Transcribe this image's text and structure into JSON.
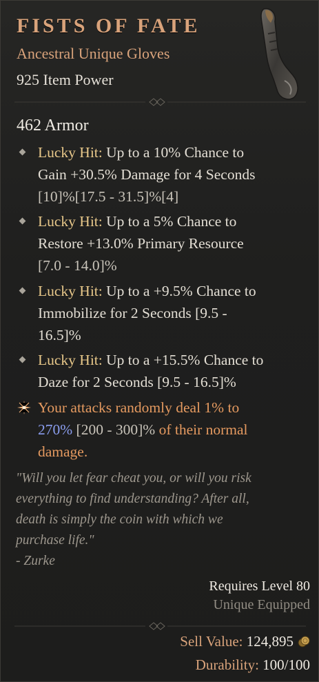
{
  "item": {
    "name": "FISTS OF FATE",
    "type": "Ancestral Unique Gloves",
    "item_power": "925 Item Power",
    "armor": "462 Armor",
    "image_icon": "gloves-icon"
  },
  "affixes": [
    {
      "prefix": "Lucky Hit:",
      "line1": " Up to a 10% Chance to",
      "line2": "Gain +30.5% Damage for 4 Seconds",
      "line3": "[10]%[17.5 - 31.5]%[4]"
    },
    {
      "prefix": "Lucky Hit:",
      "line1": " Up to a 5% Chance to",
      "line2": "Restore +13.0% Primary Resource",
      "line3": "[7.0 - 14.0]%"
    },
    {
      "prefix": "Lucky Hit:",
      "line1": " Up to a +9.5% Chance to",
      "line2": "Immobilize for 2 Seconds [9.5 -",
      "line3": "16.5]%"
    },
    {
      "prefix": "Lucky Hit:",
      "line1": " Up to a +15.5% Chance to",
      "line2": "Daze for 2 Seconds [9.5 - 16.5]%"
    }
  ],
  "unique_power": {
    "part1": "Your attacks randomly deal 1% to",
    "value": "270%",
    "range": " [200 - 300]%",
    "part2": " of their normal",
    "part3": "damage.",
    "icon": "unique-star-icon"
  },
  "flavor": {
    "line1": "\"Will you let fear cheat you, or will you risk",
    "line2": "everything to find understanding? After all,",
    "line3": "death is simply the coin with which we",
    "line4": "purchase life.\"",
    "author": "- Zurke"
  },
  "footer": {
    "requires": "Requires Level 80",
    "equipped": "Unique Equipped",
    "sell_label": "Sell Value:",
    "sell_value": " 124,895",
    "durability_label": "Durability:",
    "durability_value": " 100/100",
    "coin_icon": "gold-coin-icon"
  },
  "colors": {
    "title": "#d9a37b",
    "lucky_hit": "#e8c88a",
    "unique_text": "#e59a60",
    "unique_value": "#8b9ef0",
    "flavor": "#9d978d"
  }
}
